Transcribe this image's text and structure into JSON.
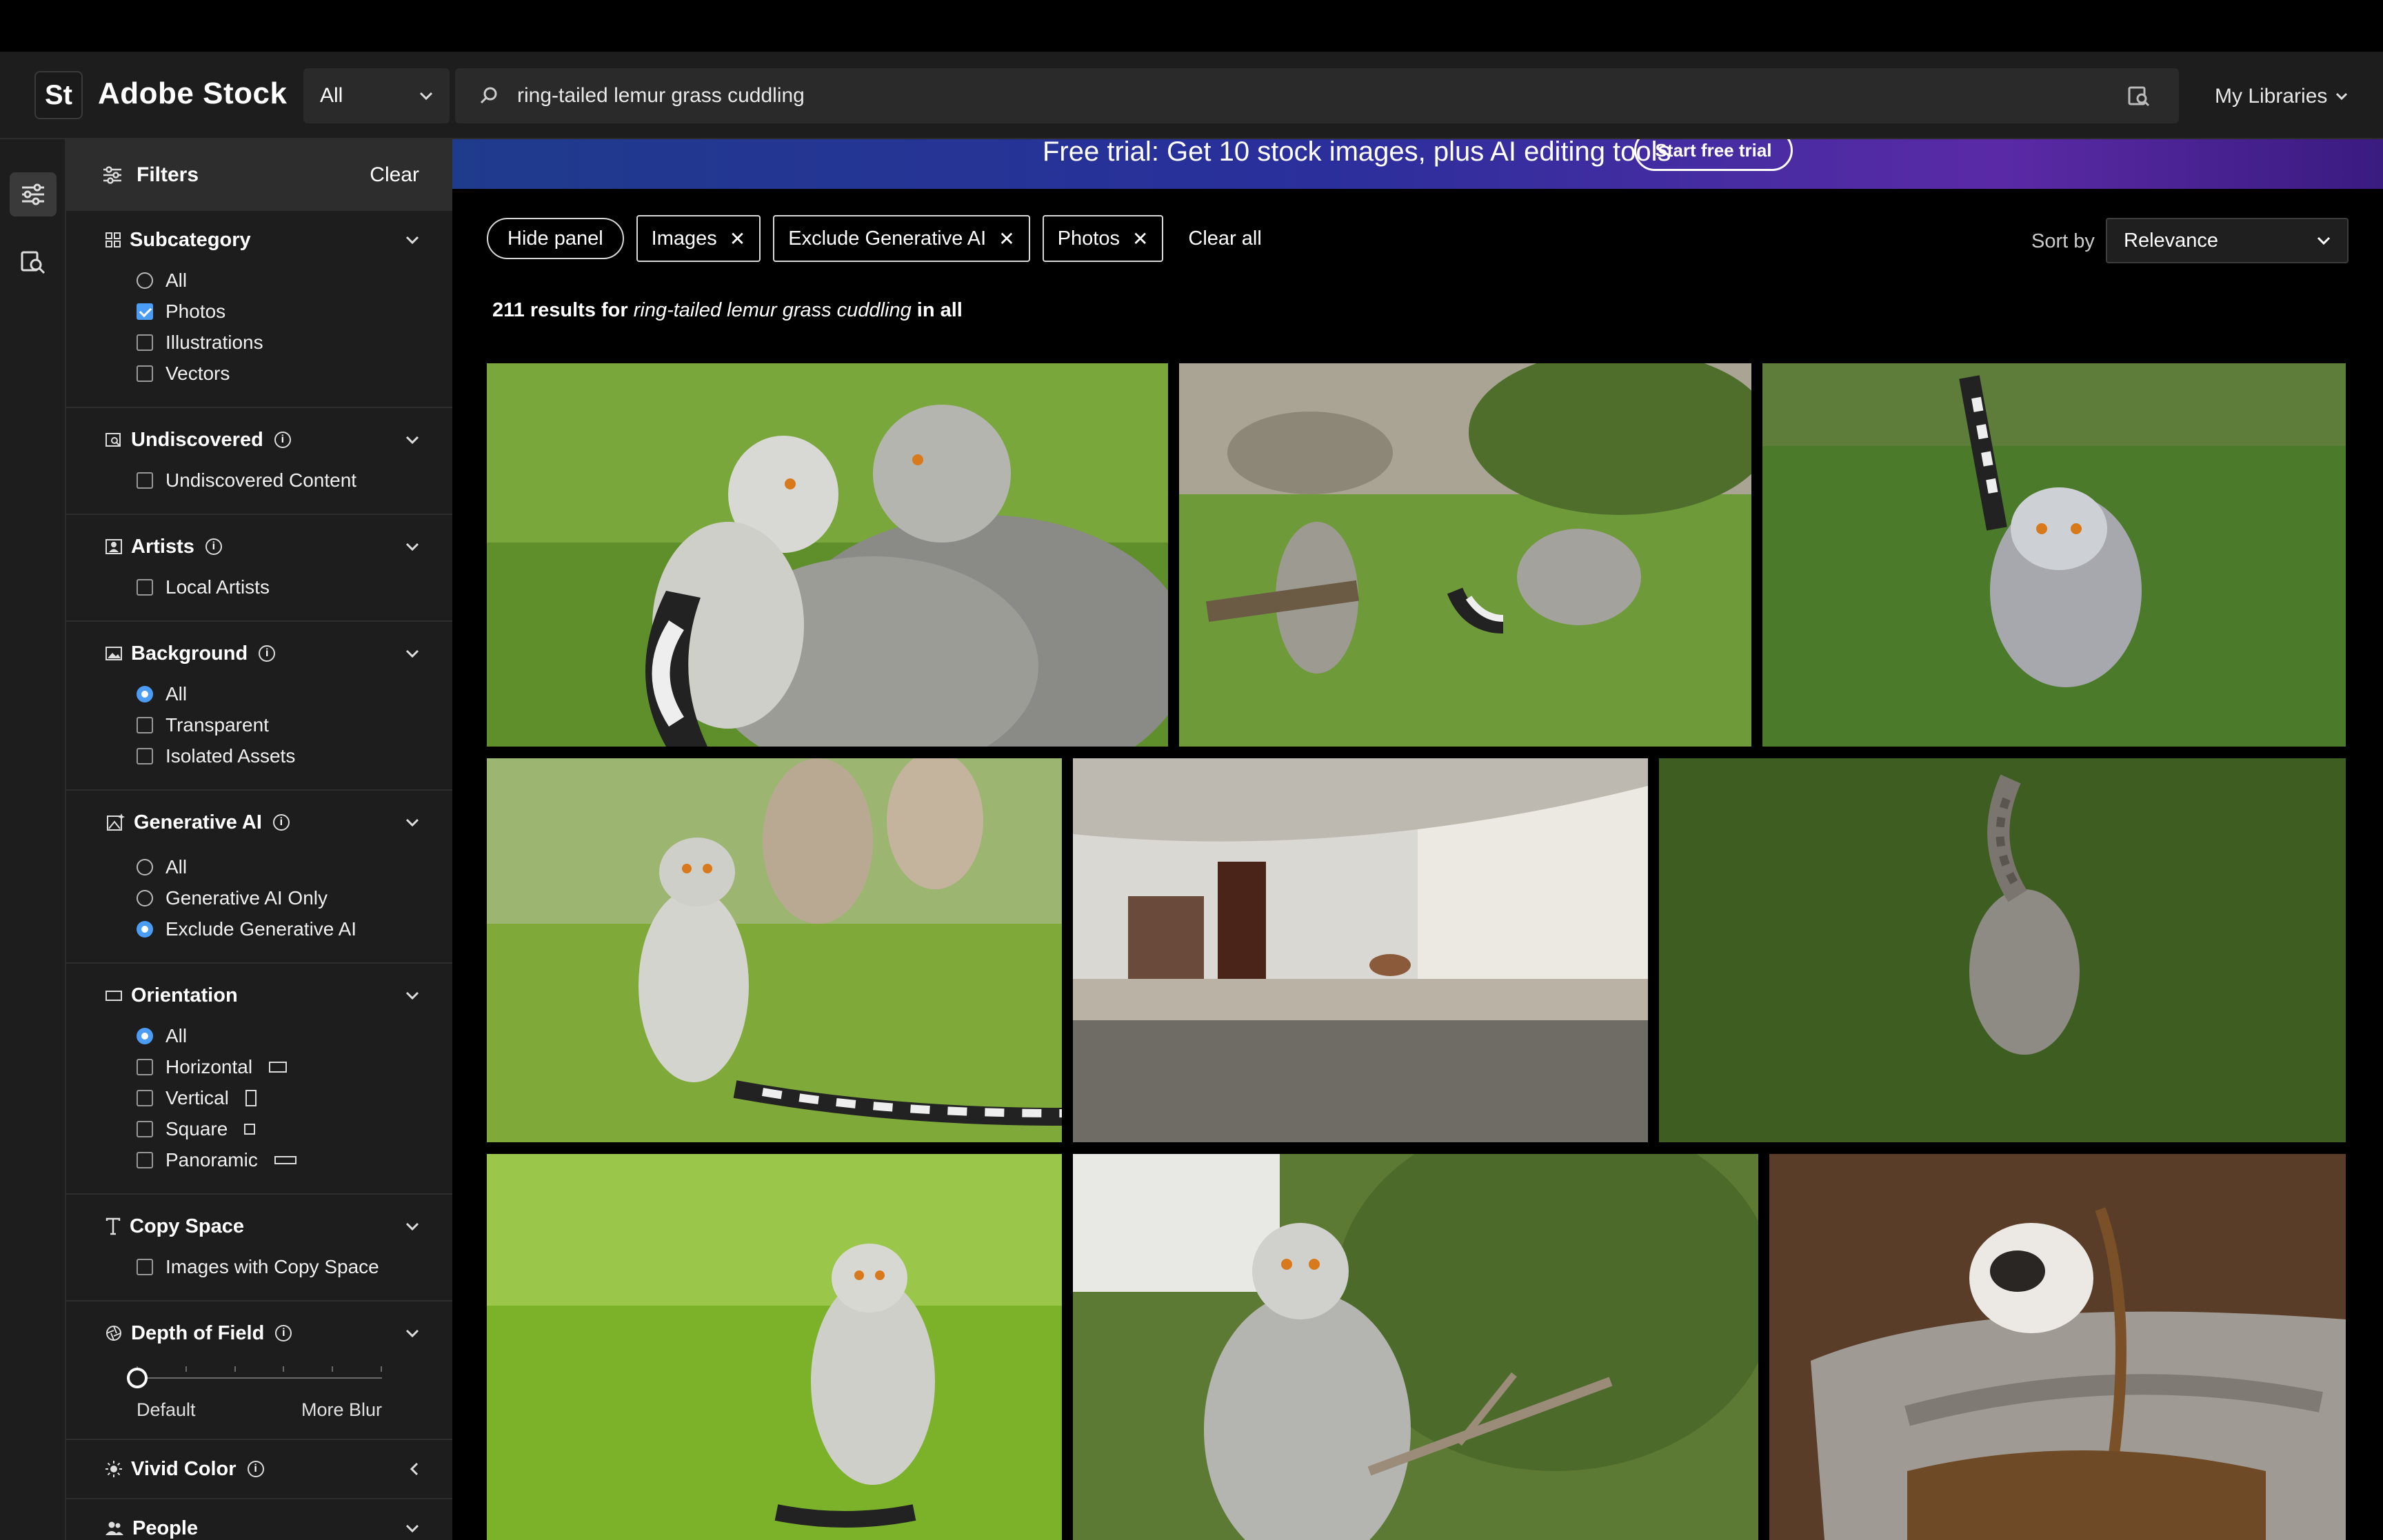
{
  "header": {
    "logo_text": "St",
    "brand": "Adobe Stock",
    "scope": "All",
    "search_value": "ring-tailed lemur grass cuddling",
    "my_libraries": "My Libraries"
  },
  "promo": {
    "text": "Free trial: Get 10 stock images, plus AI editing tools",
    "button": "Start free trial"
  },
  "filters": {
    "title": "Filters",
    "clear": "Clear",
    "subcategory": {
      "title": "Subcategory",
      "options": [
        "All",
        "Photos",
        "Illustrations",
        "Vectors"
      ],
      "selected": "Photos"
    },
    "undiscovered": {
      "title": "Undiscovered",
      "options": [
        "Undiscovered Content"
      ]
    },
    "artists": {
      "title": "Artists",
      "options": [
        "Local Artists"
      ]
    },
    "background": {
      "title": "Background",
      "options": [
        "All",
        "Transparent",
        "Isolated Assets"
      ],
      "selected": "All"
    },
    "generative": {
      "title": "Generative AI",
      "options": [
        "All",
        "Generative AI Only",
        "Exclude Generative AI"
      ],
      "selected": "Exclude Generative AI"
    },
    "orientation": {
      "title": "Orientation",
      "options": [
        "All",
        "Horizontal",
        "Vertical",
        "Square",
        "Panoramic"
      ],
      "selected": "All"
    },
    "copy_space": {
      "title": "Copy Space",
      "options": [
        "Images with Copy Space"
      ]
    },
    "depth": {
      "title": "Depth of Field",
      "min_label": "Default",
      "max_label": "More Blur",
      "value": 0
    },
    "vivid": {
      "title": "Vivid Color"
    },
    "people": {
      "title": "People"
    }
  },
  "toolbar": {
    "hide_panel": "Hide panel",
    "chips": [
      "Images",
      "Exclude Generative AI",
      "Photos"
    ],
    "clear_all": "Clear all",
    "sort_label": "Sort by",
    "sort_value": "Relevance"
  },
  "results": {
    "count": "211",
    "pre": " results for ",
    "query": "ring-tailed lemur grass cuddling",
    "post": " in all"
  },
  "colors": {
    "accent": "#4b9cf5",
    "panel": "#1d1d1d",
    "chip_border": "#d8d8d8"
  }
}
